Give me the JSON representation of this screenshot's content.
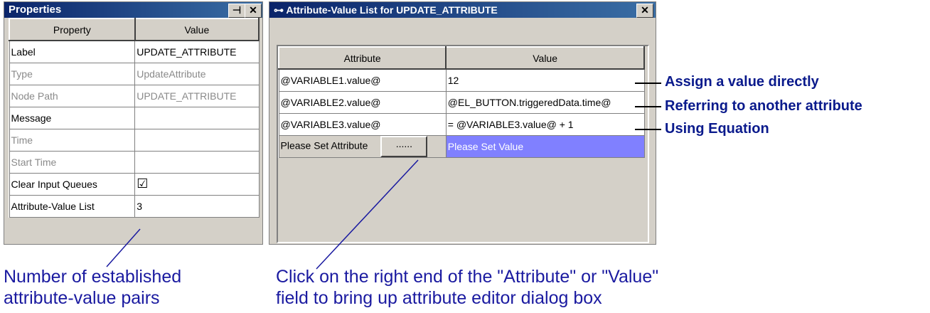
{
  "properties": {
    "title": "Properties",
    "pin_glyph": "⊣",
    "close_glyph": "✕",
    "columns": [
      "Property",
      "Value"
    ],
    "rows": [
      {
        "property": "Label",
        "value": "UPDATE_ATTRIBUTE",
        "dim": false
      },
      {
        "property": "Type",
        "value": "UpdateAttribute",
        "dim": true
      },
      {
        "property": "Node Path",
        "value": "UPDATE_ATTRIBUTE",
        "dim": true
      },
      {
        "property": "Message",
        "value": "",
        "dim": false
      },
      {
        "property": "Time",
        "value": "",
        "dim": true
      },
      {
        "property": "Start Time",
        "value": "",
        "dim": true
      },
      {
        "property": "Clear Input Queues",
        "value": "☑",
        "dim": false
      },
      {
        "property": "Attribute-Value List",
        "value": "3",
        "dim": false
      }
    ]
  },
  "av_window": {
    "title": "Attribute-Value List for UPDATE_ATTRIBUTE",
    "title_icon": "⊶",
    "close_glyph": "✕",
    "columns": [
      "Attribute",
      "Value"
    ],
    "rows": [
      {
        "attribute": "@VARIABLE1.value@",
        "value": "12"
      },
      {
        "attribute": "@VARIABLE2.value@",
        "value": "@EL_BUTTON.triggeredData.time@"
      },
      {
        "attribute": "@VARIABLE3.value@",
        "value": "= @VARIABLE3.value@ + 1"
      }
    ],
    "placeholder_attribute": "Please Set Attribute",
    "editor_button": "......",
    "placeholder_value": "Please Set Value",
    "accent": "#8080ff"
  },
  "annotations": {
    "assign": "Assign a value directly",
    "refer": "Referring to another attribute",
    "equation": "Using Equation",
    "pairs_line1": "Number of established",
    "pairs_line2": "attribute-value pairs",
    "click_line1": "Click on the right end of the \"Attribute\" or \"Value\"",
    "click_line2": "field to bring up attribute editor dialog box"
  }
}
